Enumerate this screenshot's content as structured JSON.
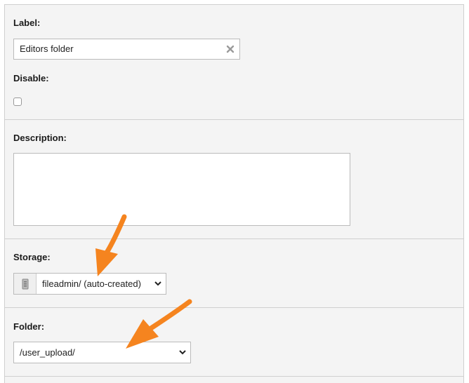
{
  "label_field": {
    "label": "Label:",
    "value": "Editors folder",
    "clear_icon": "clear-x-icon"
  },
  "disable_field": {
    "label": "Disable:",
    "checked": false
  },
  "description_field": {
    "label": "Description:",
    "value": ""
  },
  "storage_field": {
    "label": "Storage:",
    "selected": "fileadmin/ (auto-created)",
    "addon_icon": "storage-drive-icon"
  },
  "folder_field": {
    "label": "Folder:",
    "selected": "/user_upload/"
  },
  "annotations": {
    "arrow_color": "#f5841f"
  }
}
